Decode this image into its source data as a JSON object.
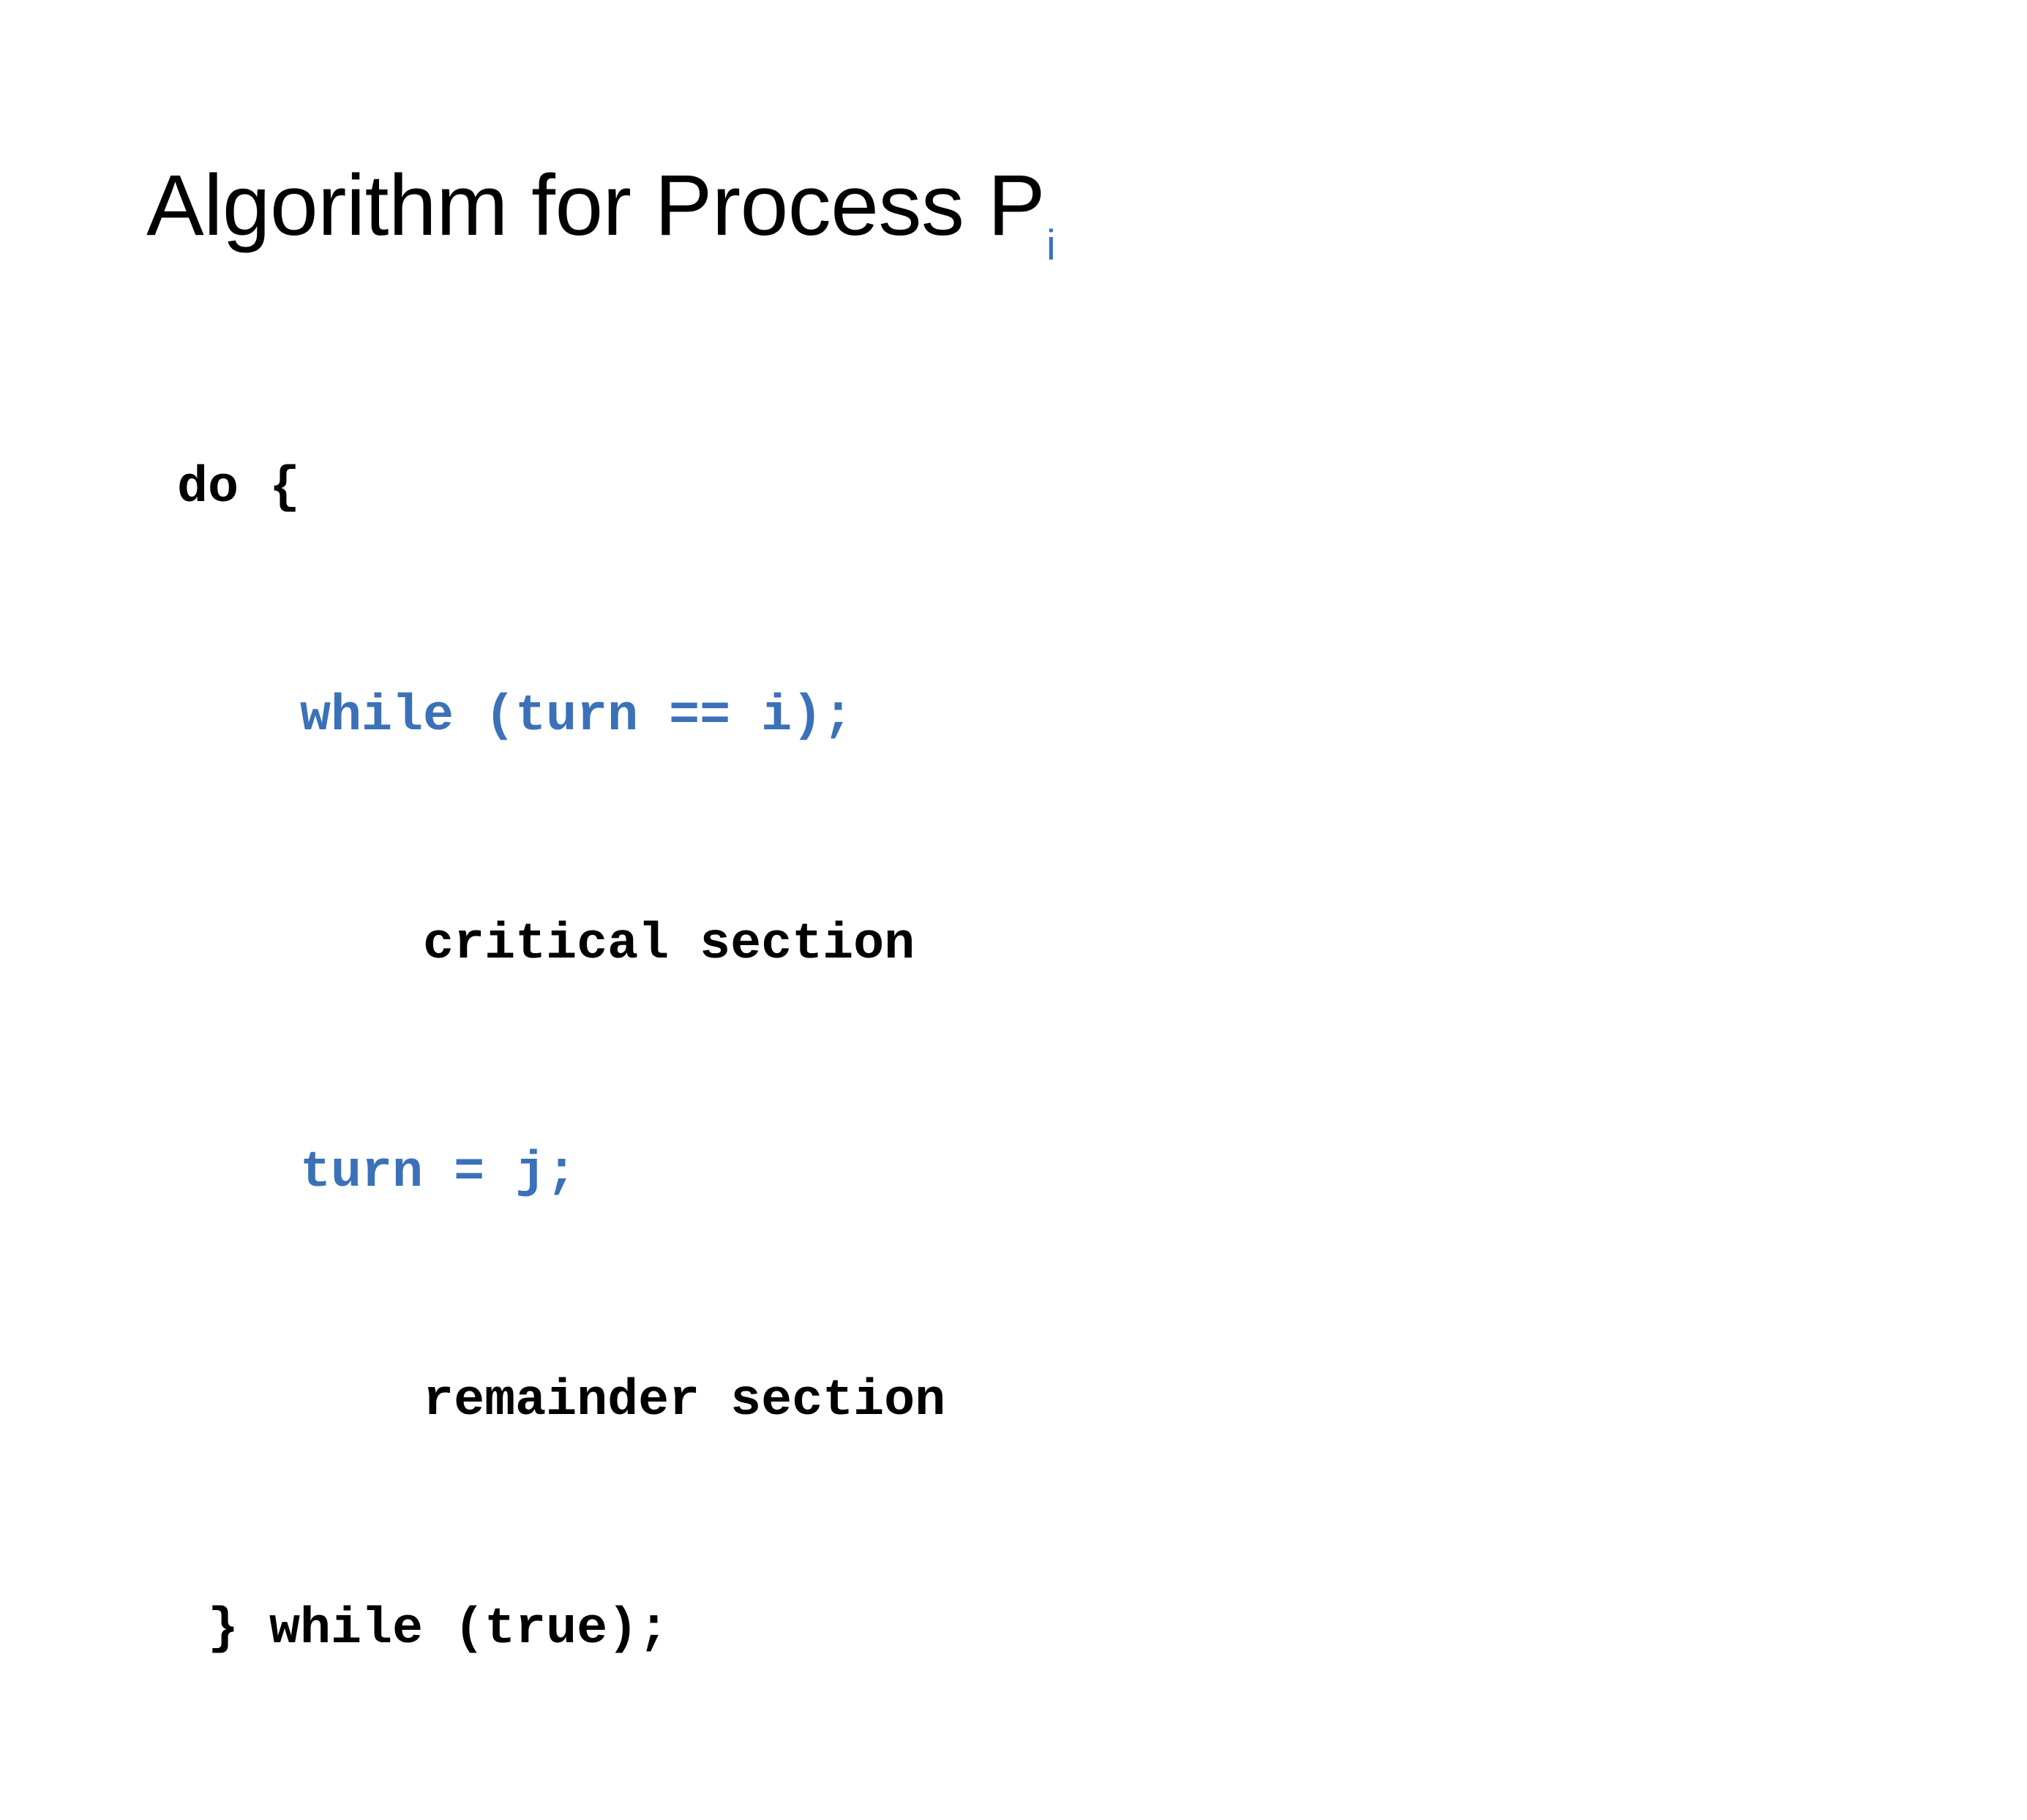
{
  "slide": {
    "background_color": "#ffffff",
    "title": {
      "main_text": "Algorithm for Process P",
      "subscript_text": "i",
      "subscript_color": "#3b71b8",
      "text_color": "#000000"
    },
    "code": {
      "accent_color": "#3b71b8",
      "default_color": "#000000",
      "lines": [
        {
          "text": " do {",
          "color": "black"
        },
        {
          "text": "     while (turn == i);",
          "color": "blue"
        },
        {
          "text": "         critical section",
          "color": "black"
        },
        {
          "text": "     turn = j;",
          "color": "blue"
        },
        {
          "text": "         remainder section",
          "color": "black"
        },
        {
          "text": "  } while (true);",
          "color": "black"
        }
      ]
    }
  }
}
